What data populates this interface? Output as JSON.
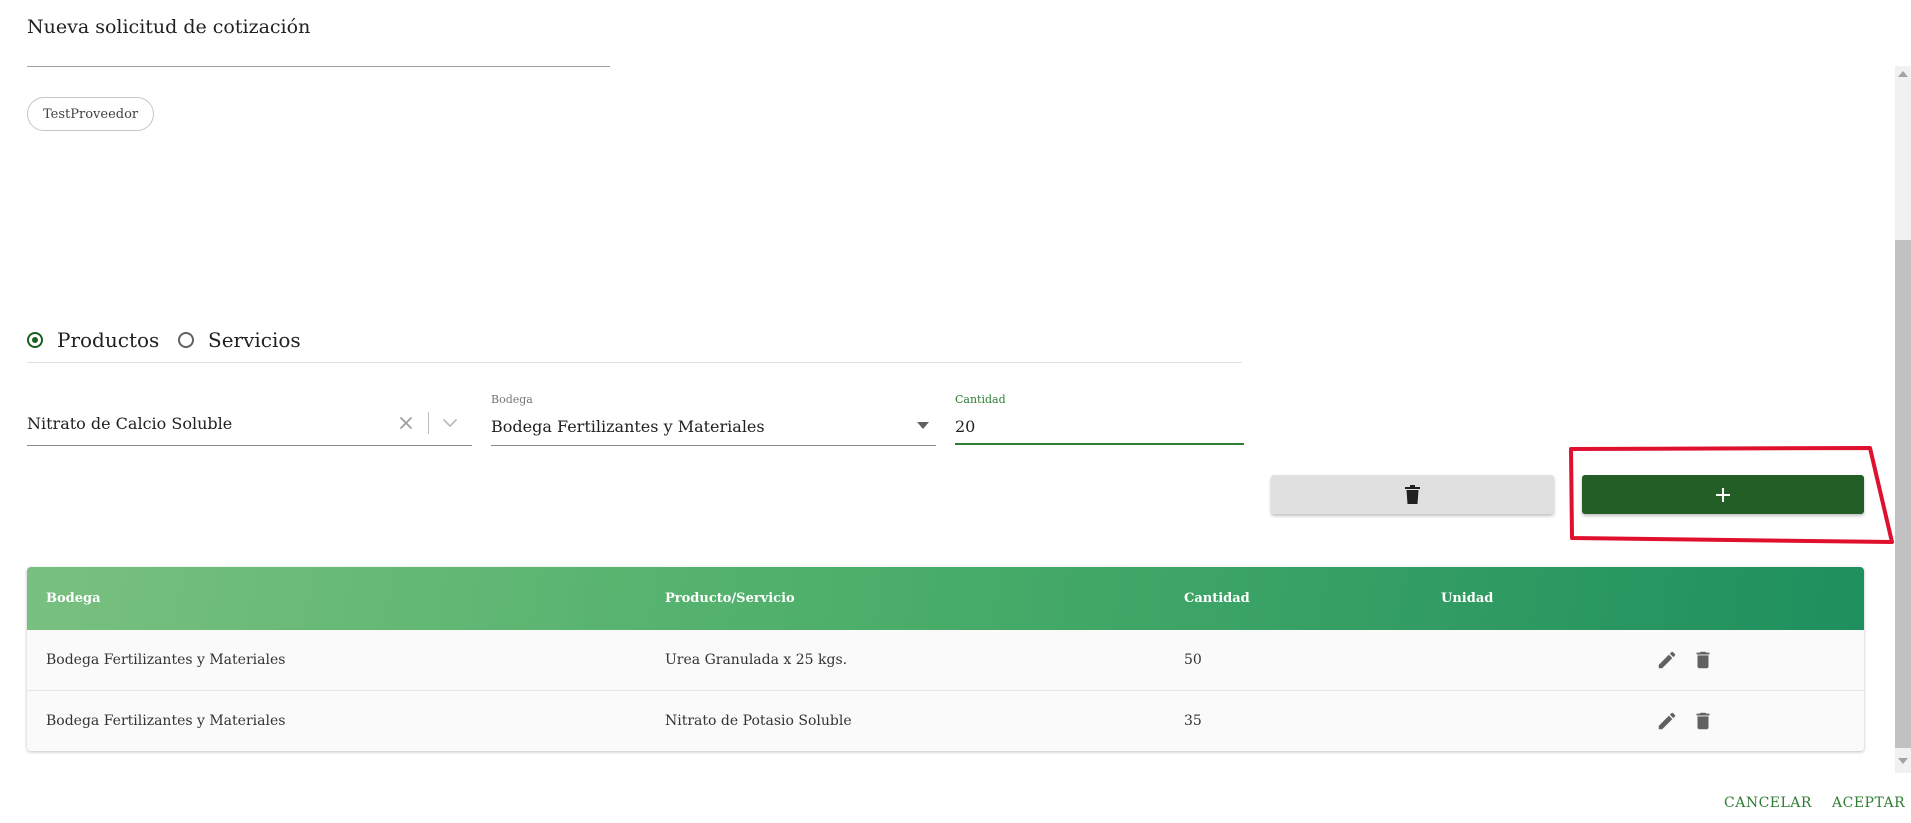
{
  "dialog": {
    "title": "Nueva solicitud de cotización"
  },
  "supplier_chip": {
    "label": "TestProveedor"
  },
  "item_type": {
    "options": [
      {
        "label": "Productos",
        "selected": true
      },
      {
        "label": "Servicios",
        "selected": false
      }
    ]
  },
  "form": {
    "product": {
      "value": "Nitrato de Calcio Soluble"
    },
    "warehouse": {
      "label": "Bodega",
      "value": "Bodega Fertilizantes y Materiales"
    },
    "quantity": {
      "label": "Cantidad",
      "value": "20"
    }
  },
  "buttons": {
    "delete_icon": "trash-icon",
    "add_icon": "plus-icon",
    "add_symbol": "+"
  },
  "table": {
    "columns": [
      "Bodega",
      "Producto/Servicio",
      "Cantidad",
      "Unidad"
    ],
    "rows": [
      {
        "bodega": "Bodega Fertilizantes y Materiales",
        "producto": "Urea Granulada x 25 kgs.",
        "cantidad": "50",
        "unidad": ""
      },
      {
        "bodega": "Bodega Fertilizantes y Materiales",
        "producto": "Nitrato de Potasio Soluble",
        "cantidad": "35",
        "unidad": ""
      }
    ]
  },
  "footer": {
    "cancel_label": "CANCELAR",
    "accept_label": "ACEPTAR"
  },
  "colors": {
    "primary": "#235e26",
    "accent_text": "#2e7d32",
    "header_gradient_start": "#79c080",
    "header_gradient_end": "#1e8f5e",
    "highlight": "#e0102f"
  }
}
